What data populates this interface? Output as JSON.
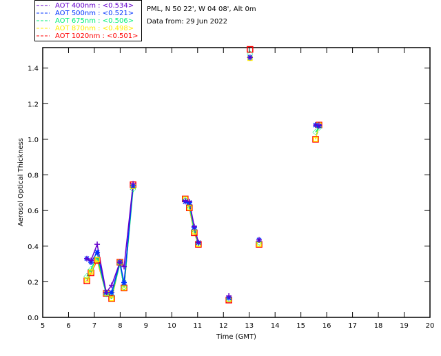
{
  "header": {
    "site": "PML, N 50 22', W 04 08', Alt 0m",
    "date": "Data from: 29 Jun 2022"
  },
  "chart_data": {
    "type": "scatter",
    "title": "",
    "xlabel": "Time (GMT)",
    "ylabel": "Aerosol Optical Thickness",
    "xlim": [
      5,
      20
    ],
    "ylim": [
      0,
      1.515
    ],
    "xticks": [
      5,
      6,
      7,
      8,
      9,
      10,
      11,
      12,
      13,
      14,
      15,
      16,
      17,
      18,
      19,
      20
    ],
    "yticks": [
      "0.0",
      "0.2",
      "0.4",
      "0.6",
      "0.8",
      "1.0",
      "1.2",
      "1.4"
    ],
    "grid": false,
    "legend_position": "top-left",
    "x": [
      6.71,
      6.87,
      7.11,
      7.46,
      7.67,
      7.99,
      8.15,
      8.5,
      10.52,
      10.68,
      10.87,
      11.03,
      12.21,
      13.03,
      13.38,
      15.57,
      15.7
    ],
    "series": [
      {
        "name": "AOT  400nm : <0.534>",
        "color": "#6600cc",
        "marker": "plus",
        "values": [
          0.33,
          0.32,
          0.41,
          0.14,
          0.18,
          0.31,
          0.285,
          0.75,
          0.655,
          0.65,
          0.51,
          0.42,
          0.12,
          1.46,
          0.435,
          1.08,
          1.08
        ]
      },
      {
        "name": "AOT  500nm : <0.521>",
        "color": "#0033ff",
        "marker": "star",
        "values": [
          0.33,
          0.31,
          0.365,
          0.14,
          0.14,
          0.31,
          0.195,
          0.74,
          0.65,
          0.645,
          0.505,
          0.42,
          0.11,
          1.46,
          0.435,
          1.08,
          1.075
        ]
      },
      {
        "name": "AOT  675nm : <0.506>",
        "color": "#00ee77",
        "marker": "diamond",
        "values": [
          0.23,
          0.27,
          0.34,
          0.13,
          0.12,
          0.3,
          0.17,
          0.72,
          0.66,
          0.625,
          0.49,
          0.415,
          0.1,
          1.48,
          0.42,
          1.04,
          1.065
        ]
      },
      {
        "name": "AOT  870nm : <0.498>",
        "color": "#ffee00",
        "marker": "triangle",
        "values": [
          0.21,
          0.255,
          0.325,
          0.135,
          0.105,
          0.31,
          0.165,
          0.735,
          0.665,
          0.615,
          0.48,
          0.41,
          0.1,
          1.455,
          0.41,
          1.0,
          1.08
        ]
      },
      {
        "name": "AOT 1020nm : <0.501>",
        "color": "#ff0000",
        "marker": "square",
        "values": [
          0.205,
          0.25,
          0.32,
          0.135,
          0.105,
          0.31,
          0.165,
          0.745,
          0.665,
          0.615,
          0.475,
          0.41,
          0.097,
          1.505,
          0.41,
          1.0,
          1.08
        ]
      }
    ]
  }
}
